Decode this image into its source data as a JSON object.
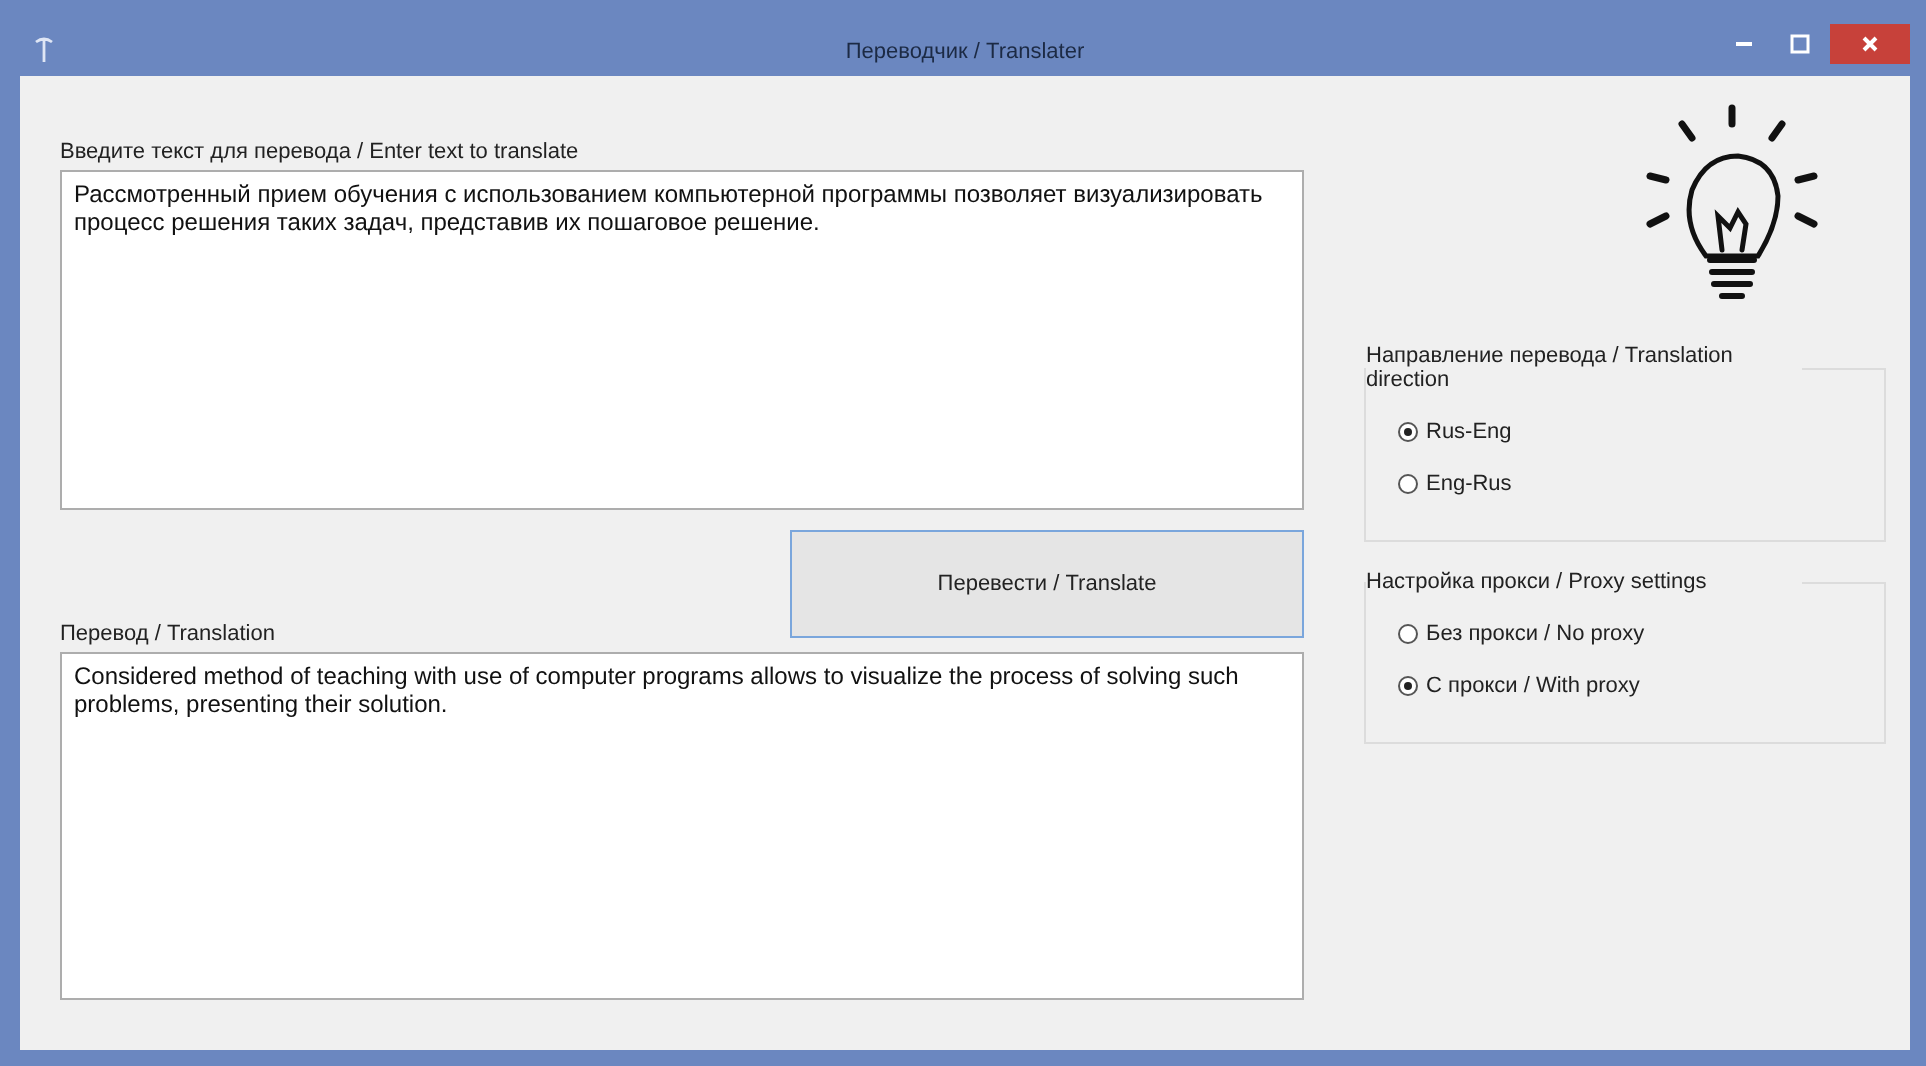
{
  "window": {
    "title": "Переводчик / Translater"
  },
  "input": {
    "label": "Введите текст для перевода / Enter text to translate",
    "value": "Рассмотренный прием обучения с использованием компьютерной программы позволяет визуализировать процесс решения таких задач, представив их пошаговое решение."
  },
  "translate_button": {
    "label": "Перевести / Translate"
  },
  "output": {
    "label": "Перевод / Translation",
    "value": "Considered method of teaching with use of computer programs allows to visualize the process of solving such problems, presenting their solution."
  },
  "groups": [
    {
      "title": "Направление перевода / Translation direction",
      "options": [
        {
          "label": "Rus-Eng",
          "selected": true
        },
        {
          "label": "Eng-Rus",
          "selected": false
        }
      ]
    },
    {
      "title": "Настройка прокси / Proxy settings",
      "options": [
        {
          "label": "Без прокси / No proxy",
          "selected": false
        },
        {
          "label": "С прокси / With proxy",
          "selected": true
        }
      ]
    }
  ]
}
